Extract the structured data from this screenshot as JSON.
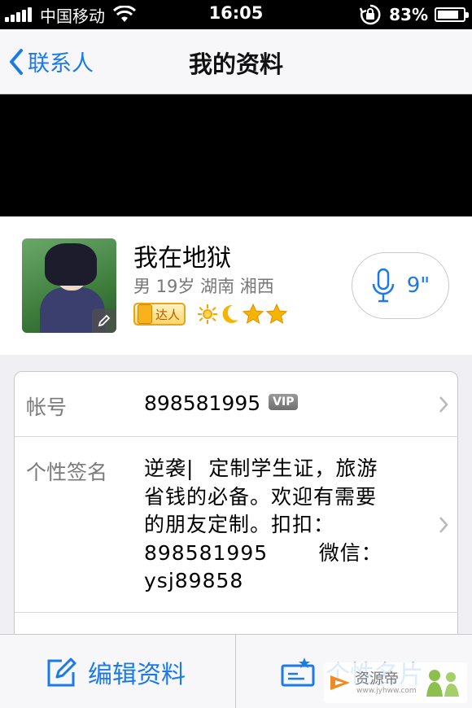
{
  "status_bar": {
    "carrier": "中国移动",
    "time": "16:05",
    "battery": "83%",
    "battery_level": 0.83
  },
  "nav": {
    "back_label": "联系人",
    "title": "我的资料"
  },
  "profile": {
    "name": "我在地狱",
    "meta": "男  19岁  湖南 湘西",
    "talent_badge": "达人",
    "voice_duration": "9\""
  },
  "info": {
    "account_label": "帐号",
    "account_value": "898581995",
    "vip_badge": "VIP",
    "signature_label": "个性签名",
    "signature_value": "逆袭|  定制学生证，旅游省钱的必备。欢迎有需要的朋友定制。扣扣：898581995       微信：ysj89858"
  },
  "toolbar": {
    "edit_label": "编辑资料",
    "card_label": "个性名片"
  },
  "watermark": {
    "main": "资源帝",
    "sub": "www.jyhww.com"
  },
  "colors": {
    "accent": "#1a7ae8",
    "status_bar": "#000000",
    "background": "#efeff4"
  }
}
